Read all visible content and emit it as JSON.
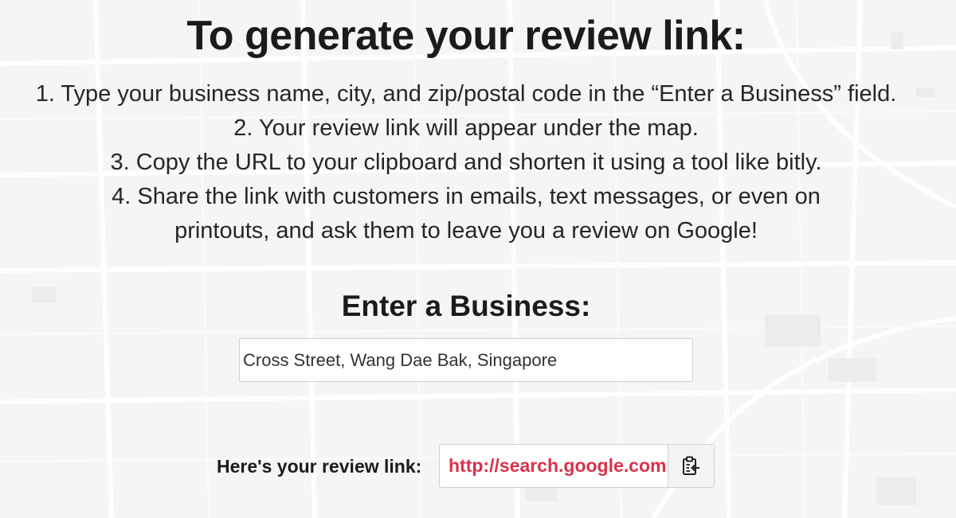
{
  "headline": "To generate your review link:",
  "instructions": {
    "step1": "1. Type your business name, city, and zip/postal code in the “Enter a Business” field.",
    "step2": "2. Your review link will appear under the map.",
    "step3": "3. Copy the URL to your clipboard and shorten it using a tool like bitly.",
    "step4_line1": "4. Share the link with customers in emails, text messages, or even on",
    "step4_line2": "printouts, and ask them to leave you a review on Google!"
  },
  "business_section": {
    "heading": "Enter a Business:",
    "input_value": "Cross Street, Wang Dae Bak, Singapore"
  },
  "review_link": {
    "label": "Here's your review link:",
    "value": "http://search.google.com",
    "copy_icon": "clipboard-copy-icon"
  },
  "colors": {
    "link_text": "#d8324b",
    "background": "#f6f6f6",
    "heading": "#1b1b1b"
  }
}
